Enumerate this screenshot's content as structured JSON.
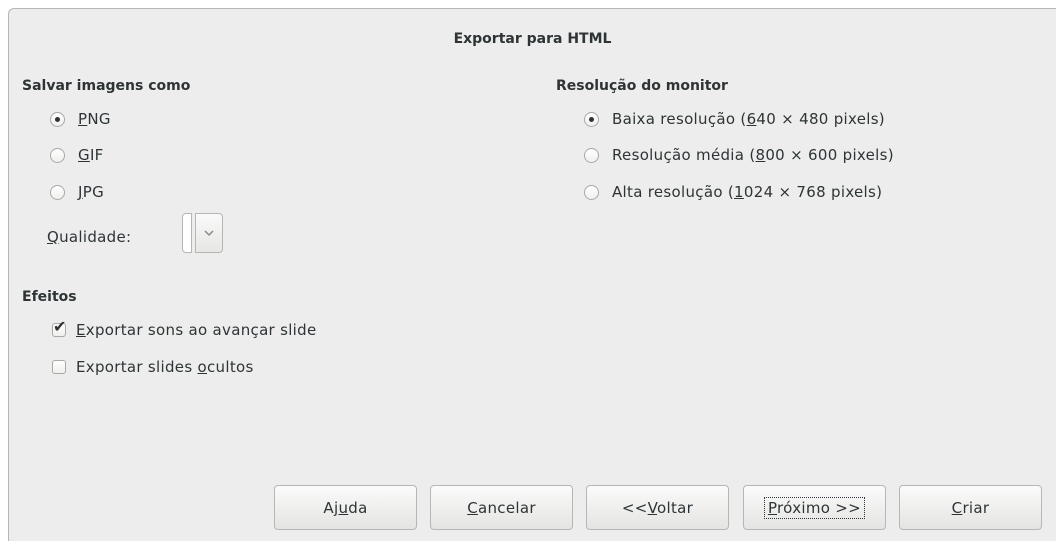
{
  "dialog": {
    "title": "Exportar para HTML"
  },
  "images": {
    "heading": "Salvar imagens como",
    "options": [
      {
        "pre": "",
        "mn": "P",
        "post": "NG",
        "checked": true
      },
      {
        "pre": "",
        "mn": "G",
        "post": "IF",
        "checked": false
      },
      {
        "pre": "",
        "mn": "J",
        "post": "PG",
        "checked": false
      }
    ],
    "quality": {
      "mn": "Q",
      "post": "ualidade:",
      "value": ""
    }
  },
  "effects": {
    "heading": "Efeitos",
    "options": [
      {
        "pre": "",
        "mn": "E",
        "post": "xportar sons ao avançar slide",
        "checked": true
      },
      {
        "pre": "Exportar slides ",
        "mn": "o",
        "post": "cultos",
        "checked": false
      }
    ]
  },
  "resolution": {
    "heading": "Resolução do monitor",
    "options": [
      {
        "pre": "Baixa resolução (",
        "mn": "6",
        "post": "40 × 480 pixels)",
        "checked": true
      },
      {
        "pre": "Resolução média (",
        "mn": "8",
        "post": "00 × 600 pixels)",
        "checked": false
      },
      {
        "pre": "Alta resolução (",
        "mn": "1",
        "post": "024 × 768 pixels)",
        "checked": false
      }
    ]
  },
  "buttons": {
    "help": {
      "pre": "Aj",
      "mn": "u",
      "post": "da"
    },
    "cancel": {
      "pre": "",
      "mn": "C",
      "post": "ancelar"
    },
    "back": {
      "pre": "<<",
      "mn": "V",
      "post": "oltar"
    },
    "next": {
      "pre": "",
      "mn": "P",
      "post": "róximo >>"
    },
    "create": {
      "pre": "",
      "mn": "C",
      "post": "riar"
    }
  },
  "icons": {
    "spin_arrow": "chevron-down-icon",
    "check_mark": "checkmark-icon"
  }
}
